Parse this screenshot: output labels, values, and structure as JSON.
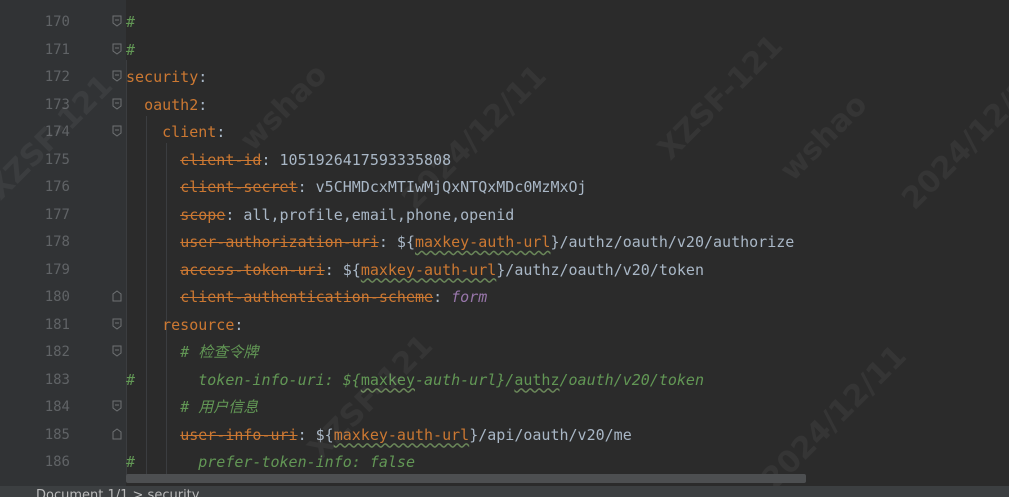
{
  "editor": {
    "lines": [
      {
        "num": "170",
        "hash": "#",
        "indent": "",
        "parts": []
      },
      {
        "num": "171",
        "hash": "#",
        "indent": "",
        "parts": []
      },
      {
        "num": "172",
        "indent": "",
        "parts": [
          {
            "t": "security",
            "c": "k"
          },
          {
            "t": ":",
            "c": "p"
          }
        ]
      },
      {
        "num": "173",
        "indent": "  ",
        "parts": [
          {
            "t": "oauth2",
            "c": "k"
          },
          {
            "t": ":",
            "c": "p"
          }
        ]
      },
      {
        "num": "174",
        "indent": "    ",
        "parts": [
          {
            "t": "client",
            "c": "k"
          },
          {
            "t": ":",
            "c": "p"
          }
        ]
      },
      {
        "num": "175",
        "indent": "      ",
        "parts": [
          {
            "t": "client-id",
            "c": "kd"
          },
          {
            "t": ": 1051926417593335808",
            "c": "v"
          }
        ]
      },
      {
        "num": "176",
        "indent": "      ",
        "parts": [
          {
            "t": "client-secret",
            "c": "kd"
          },
          {
            "t": ": v5CHMDcxMTIwMjQxNTQxMDc0MzMxOj",
            "c": "v"
          }
        ]
      },
      {
        "num": "177",
        "indent": "      ",
        "parts": [
          {
            "t": "scope",
            "c": "kd"
          },
          {
            "t": ": all,profile,email,phone,openid",
            "c": "v"
          }
        ]
      },
      {
        "num": "178",
        "indent": "      ",
        "parts": [
          {
            "t": "user-authorization-uri",
            "c": "kd"
          },
          {
            "t": ": ${",
            "c": "v"
          },
          {
            "t": "maxkey-auth-url",
            "c": "uv"
          },
          {
            "t": "}/authz/oauth/v20/authorize",
            "c": "v"
          }
        ]
      },
      {
        "num": "179",
        "indent": "      ",
        "parts": [
          {
            "t": "access-token-uri",
            "c": "kd"
          },
          {
            "t": ": ${",
            "c": "v"
          },
          {
            "t": "maxkey-auth-url",
            "c": "uv"
          },
          {
            "t": "}/authz/oauth/v20/token",
            "c": "v"
          }
        ]
      },
      {
        "num": "180",
        "indent": "      ",
        "parts": [
          {
            "t": "client-authentication-scheme",
            "c": "kd"
          },
          {
            "t": ": ",
            "c": "v"
          },
          {
            "t": "form",
            "c": "e"
          }
        ]
      },
      {
        "num": "181",
        "indent": "    ",
        "parts": [
          {
            "t": "resource",
            "c": "k"
          },
          {
            "t": ":",
            "c": "p"
          }
        ]
      },
      {
        "num": "182",
        "indent": "      ",
        "parts": [
          {
            "t": "# 检查令牌",
            "c": "c"
          }
        ]
      },
      {
        "num": "183",
        "hash": "#",
        "indent": "       ",
        "parts": [
          {
            "t": "token-info-uri: ${",
            "c": "c"
          },
          {
            "t": "maxkey",
            "c": "uvc"
          },
          {
            "t": "-auth-url}/",
            "c": "c"
          },
          {
            "t": "authz",
            "c": "uvc"
          },
          {
            "t": "/oauth/v20/token",
            "c": "c"
          }
        ]
      },
      {
        "num": "184",
        "indent": "      ",
        "parts": [
          {
            "t": "# 用户信息",
            "c": "c"
          }
        ]
      },
      {
        "num": "185",
        "indent": "      ",
        "parts": [
          {
            "t": "user-info-uri",
            "c": "kd"
          },
          {
            "t": ": ${",
            "c": "v"
          },
          {
            "t": "maxkey-auth-url",
            "c": "uv"
          },
          {
            "t": "}/api/oauth/v20/me",
            "c": "v"
          }
        ]
      },
      {
        "num": "186",
        "hash": "#",
        "indent": "       ",
        "parts": [
          {
            "t": "prefer-token-info: false",
            "c": "c"
          }
        ]
      }
    ],
    "folds": [
      "170-end",
      "171-end",
      "172",
      "173",
      "174",
      "180",
      "181",
      "182",
      "184",
      "185"
    ]
  },
  "status": {
    "text": "Document 1/1  >  security"
  },
  "watermarks": [
    "XZSF-121",
    "wshao",
    "2024/12/11",
    "XZSF-121",
    "wshao",
    "2024/12/11",
    "XZSF-121",
    "2024/12/11"
  ],
  "colors": {
    "background": "#2b2b2b",
    "gutter": "#313335",
    "key": "#cc7832",
    "value": "#a9b7c6",
    "comment": "#629755",
    "enum": "#9876aa",
    "line_number": "#606366"
  }
}
